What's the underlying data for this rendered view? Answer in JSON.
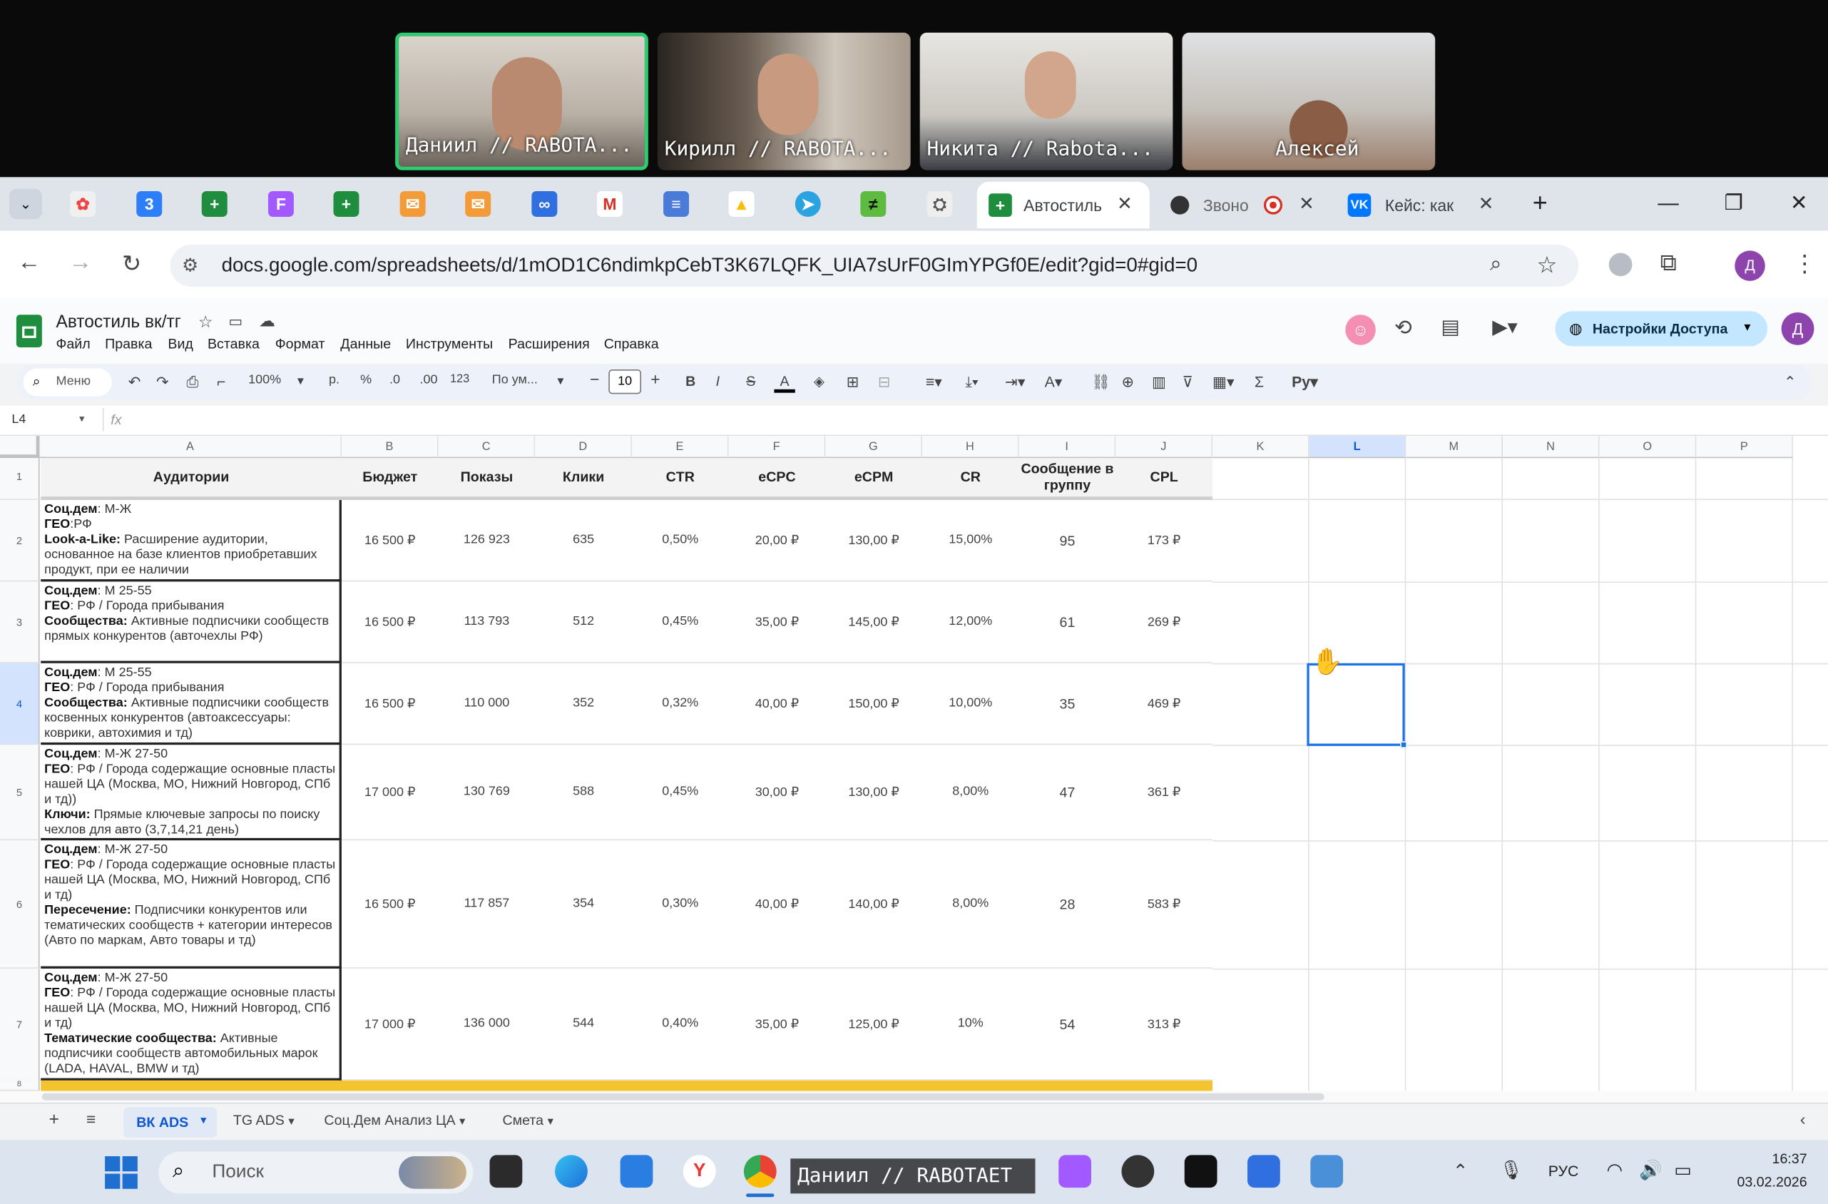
{
  "participants": [
    {
      "name": "Даниил // RABOTA..."
    },
    {
      "name": "Кирилл // RABOTA..."
    },
    {
      "name": "Никита // Rabota..."
    },
    {
      "name": "Алексей"
    }
  ],
  "browser": {
    "tabs": [
      {
        "label": "Автостиль",
        "active": true
      },
      {
        "label": "Звоно"
      },
      {
        "label": "Кейс: как"
      }
    ],
    "url": "docs.google.com/spreadsheets/d/1mOD1C6ndimkpCebT3K67LQFK_UIA7sUrF0GImYPGf0E/edit?gid=0#gid=0",
    "profile_letter": "Д"
  },
  "sheet": {
    "doc_title": "Автостиль вк/тг",
    "menus": [
      "Файл",
      "Правка",
      "Вид",
      "Вставка",
      "Формат",
      "Данные",
      "Инструменты",
      "Расширения",
      "Справка"
    ],
    "share_label": "Настройки Доступа",
    "toolbar": {
      "search": "Меню",
      "zoom": "100%",
      "currency": "р.",
      "percent": "%",
      "dec_minus": ".0",
      "dec_plus": ".00",
      "fmt123": "123",
      "font": "По ум...",
      "font_size": "10"
    },
    "cell_ref": "L4",
    "fx": "fx",
    "columns": [
      "A",
      "B",
      "C",
      "D",
      "E",
      "F",
      "G",
      "H",
      "I",
      "J",
      "K",
      "L",
      "M",
      "N",
      "O",
      "P"
    ],
    "header_row": [
      "Аудитории",
      "Бюджет",
      "Показы",
      "Клики",
      "CTR",
      "eCPC",
      "eCPM",
      "CR",
      "Сообщение в группу",
      "CPL"
    ],
    "rows": [
      {
        "num": "2",
        "values": [
          "16 500 ₽",
          "126 923",
          "635",
          "0,50%",
          "20,00 ₽",
          "130,00 ₽",
          "15,00%",
          "95",
          "173 ₽"
        ]
      },
      {
        "num": "3",
        "values": [
          "16 500 ₽",
          "113 793",
          "512",
          "0,45%",
          "35,00 ₽",
          "145,00 ₽",
          "12,00%",
          "61",
          "269 ₽"
        ]
      },
      {
        "num": "4",
        "values": [
          "16 500 ₽",
          "110 000",
          "352",
          "0,32%",
          "40,00 ₽",
          "150,00 ₽",
          "10,00%",
          "35",
          "469 ₽"
        ]
      },
      {
        "num": "5",
        "values": [
          "17 000 ₽",
          "130 769",
          "588",
          "0,45%",
          "30,00 ₽",
          "130,00 ₽",
          "8,00%",
          "47",
          "361 ₽"
        ]
      },
      {
        "num": "6",
        "values": [
          "16 500 ₽",
          "117 857",
          "354",
          "0,30%",
          "40,00 ₽",
          "140,00 ₽",
          "8,00%",
          "28",
          "583 ₽"
        ]
      },
      {
        "num": "7",
        "values": [
          "17 000 ₽",
          "136 000",
          "544",
          "0,40%",
          "35,00 ₽",
          "125,00 ₽",
          "10%",
          "54",
          "313 ₽"
        ]
      }
    ],
    "audiences": [
      [
        {
          "b": "Соц.дем",
          "t": ":  М-Ж"
        },
        {
          "b": "ГЕО",
          "t": ":РФ"
        },
        {
          "b": "Look-a-Like:",
          "t": " Расширение аудитории, основанное на  базе клиентов приобретавших продукт, при ее наличии"
        }
      ],
      [
        {
          "b": "Соц.дем",
          "t": ": М   25-55"
        },
        {
          "b": "ГЕО",
          "t": ": РФ / Города прибывания"
        },
        {
          "b": "Сообщества:",
          "t": " Активные подписчики сообществ прямых конкурентов (авточехлы РФ)"
        }
      ],
      [
        {
          "b": "Соц.дем",
          "t": ": М   25-55"
        },
        {
          "b": "ГЕО",
          "t": ": РФ / Города прибывания"
        },
        {
          "b": "Сообщества:",
          "t": " Активные подписчики сообществ косвенных конкурентов (автоаксессуары: коврики, автохимия и тд)"
        }
      ],
      [
        {
          "b": "Соц.дем",
          "t": ": М-Ж   27-50"
        },
        {
          "b": "ГЕО",
          "t": ": РФ / Города содержащие основные пласты нашей ЦА (Москва, МО, Нижний Новгород, СПб и тд))"
        },
        {
          "b": "Ключи:",
          "t": " Прямые ключевые запросы по поиску чехлов для авто (3,7,14,21 день)"
        }
      ],
      [
        {
          "b": "Соц.дем",
          "t": ": М-Ж   27-50"
        },
        {
          "b": "ГЕО",
          "t": ": РФ / Города содержащие основные пласты нашей ЦА (Москва, МО, Нижний Новгород, СПб и тд)"
        },
        {
          "b": "Пересечение:",
          "t": " Подписчики конкурентов или тематических сообществ + категории интересов (Авто по маркам, Авто товары и тд)"
        }
      ],
      [
        {
          "b": "Соц.дем",
          "t": ": М-Ж   27-50"
        },
        {
          "b": "ГЕО",
          "t": ": РФ / Города содержащие основные пласты нашей ЦА (Москва, МО, Нижний Новгород, СПб и тд)"
        },
        {
          "b": "Тематические сообщества:",
          "t": " Активные подписчики сообществ автомобильных марок (LADA, HAVAL, BMW и тд)"
        }
      ]
    ],
    "sheet_tabs": [
      "ВК ADS",
      "TG ADS",
      "Соц.Дем Анализ ЦА",
      "Смета"
    ]
  },
  "taskbar": {
    "search": "Поиск",
    "presenter": "Даниил // RABOTAET",
    "lang": "РУС",
    "time": "16:37",
    "date": "03.02.2026"
  }
}
